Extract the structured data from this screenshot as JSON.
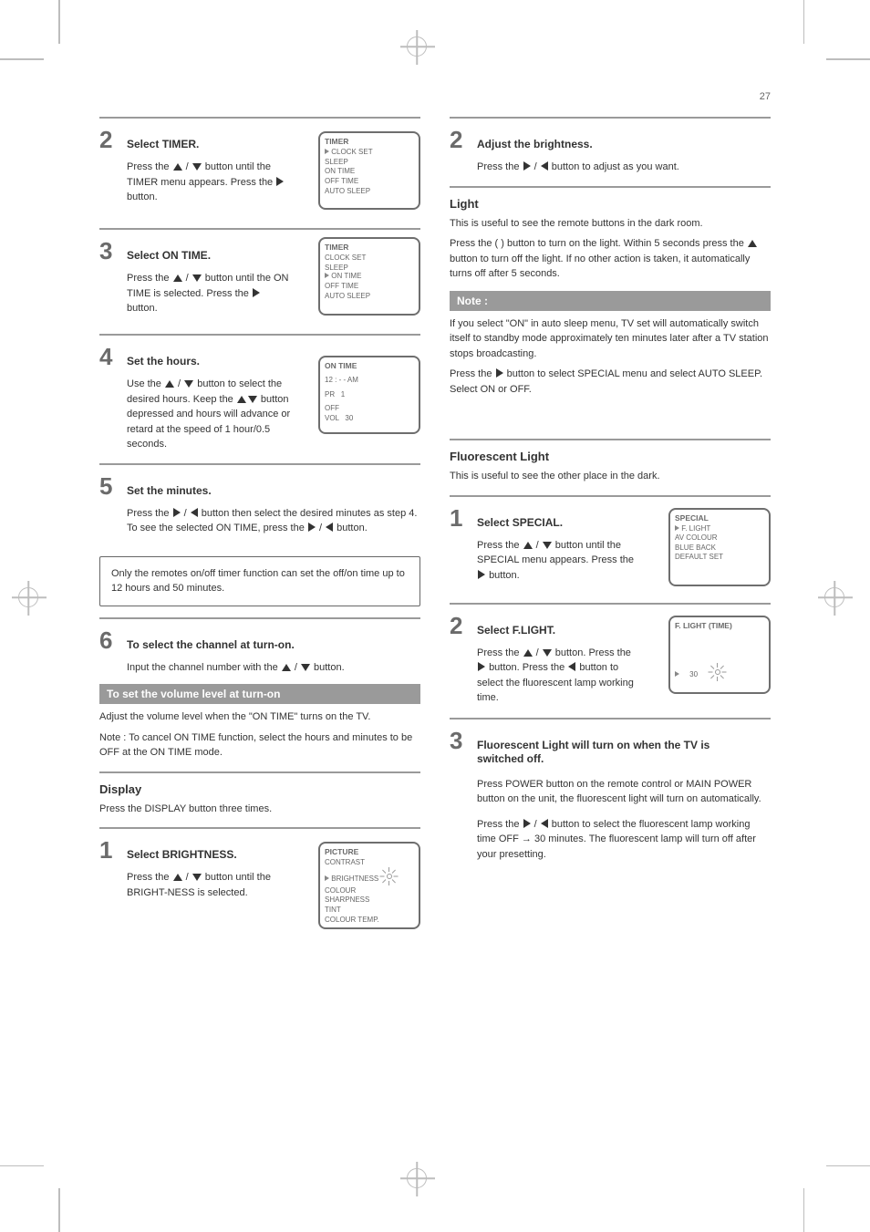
{
  "page_number": "27",
  "left": {
    "s2": {
      "title": "Select TIMER.",
      "body1": "Press the ",
      "body2": " button until the TIMER menu appears. Press the ",
      "body3": " button.",
      "screen": {
        "heading": "TIMER",
        "l1": "CLOCK SET",
        "l2": "SLEEP",
        "l3": "ON TIME",
        "l4": "OFF TIME",
        "l5": "AUTO SLEEP"
      }
    },
    "s3": {
      "title": "Select ON TIME.",
      "body1": "Press the ",
      "body2": " button until the ON TIME is selected. Press the ",
      "body3": " button.",
      "screen": {
        "heading": "TIMER",
        "l1": "CLOCK SET",
        "l2": "SLEEP",
        "l3": "ON TIME",
        "l4": "OFF TIME",
        "l5": "AUTO SLEEP"
      }
    },
    "s4": {
      "title": "Set the hours.",
      "body1": "Use the ",
      "body2": " button to select the desired hours. Keep the ",
      "body3": " button depressed and hours will advance or retard at the speed of 1 hour/0.5 seconds.",
      "screen": {
        "heading": "ON TIME",
        "l1": "12 : - - AM",
        "l2": "",
        "l3": "OFF",
        "l4": "",
        "l5": ""
      }
    },
    "s5": {
      "title": "Set the minutes.",
      "body1": "Press the ",
      "body2": " button then select the desired minutes as step 4. To see the selected ON TIME, press the ",
      "body3": " button.",
      "note": "Only the remotes on/off timer function can set the off/on time up to 12 hours and 50 minutes."
    },
    "s6": {
      "title": "To select the channel at turn-on.",
      "body1": "Input the channel number with the ",
      "body2": " button."
    },
    "gray1": {
      "heading": "To set the volume level at turn-on",
      "p1": "Adjust the volume level when the \"ON TIME\" turns on the TV.",
      "p2": "Note : To cancel ON TIME function, select the hours and minutes to be OFF at the ON TIME mode."
    },
    "display": {
      "heading": "Display",
      "text": "Press the DISPLAY button three times."
    },
    "s1b": {
      "title": "Select BRIGHTNESS.",
      "body1": "Press the ",
      "body2": " button until the BRIGHT-NESS is selected.",
      "screen": {
        "heading": "PICTURE",
        "l1": "CONTRAST",
        "l2": "BRIGHTNESS",
        "l3": "COLOUR",
        "l4": "SHARPNESS",
        "l5": "TINT",
        "l6": "COLOUR TEMP."
      }
    }
  },
  "right": {
    "s2a": {
      "title": "Adjust the brightness.",
      "body1": "Press the ",
      "body2": " button to adjust as you want."
    },
    "light": {
      "heading": "Light",
      "p1": "This is useful to see the remote buttons in the dark room.",
      "p2": "Press the  ( ) button to turn on the light. Within 5 seconds press the ",
      "p3": " button to turn off the light. If no other action is taken, it automatically turns off after 5 seconds."
    },
    "gray2": {
      "heading": "Note :",
      "p1": "If you select \"ON\" in auto sleep menu, TV set will automatically switch itself to standby mode approximately ten minutes later after a TV station stops broadcasting.",
      "p2_before": "Press the ",
      "p2_after": " button to select SPECIAL menu and select AUTO SLEEP. Select ON or OFF."
    },
    "fluo": {
      "heading": "Fluorescent Light",
      "text": "This is useful to see the other place in the dark."
    },
    "s1c": {
      "title": "Select SPECIAL.",
      "body1": "Press the ",
      "body2": " button until the SPECIAL menu appears. Press the ",
      "body3": " button.",
      "screen": {
        "heading": "SPECIAL",
        "l1": "F. LIGHT",
        "l2": "AV COLOUR",
        "l3": "BLUE BACK",
        "l4": "DEFAULT SET"
      }
    },
    "s2c": {
      "title": "Select F.LIGHT.",
      "body1": "Press the ",
      "body2": " button. Press the ",
      "body3": " button. Press the ",
      "body4": " button to select the fluorescent lamp working time.",
      "screen": {
        "heading": "F. LIGHT (TIME)",
        "l1": "",
        "l2": "30"
      }
    },
    "s3c": {
      "title": "Fluorescent Light will turn on when the TV is switched off.",
      "p1": "Press POWER button on the remote control or MAIN POWER button on the unit, the fluorescent light will turn on automatically.",
      "p2_before": "Press the ",
      "p2_mid": " button to select the fluorescent lamp working time OFF",
      "p2_arrow": "→",
      "p2_after": "30 minutes. The fluorescent lamp will turn off after your presetting."
    }
  }
}
